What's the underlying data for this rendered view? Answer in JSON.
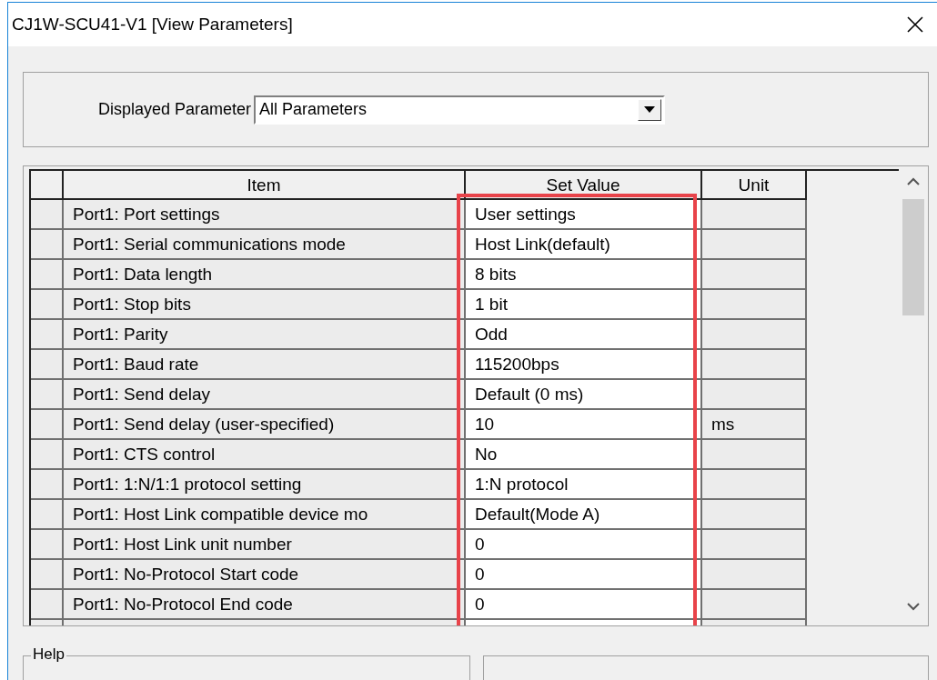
{
  "window": {
    "title": "CJ1W-SCU41-V1 [View Parameters]"
  },
  "filter": {
    "label": "Displayed Parameter",
    "value": "All Parameters"
  },
  "table": {
    "columns": [
      "Item",
      "Set Value",
      "Unit"
    ],
    "rows": [
      {
        "item": "Port1: Port settings",
        "value": "User settings"
      },
      {
        "item": "Port1: Serial communications mode",
        "value": "Host Link(default)"
      },
      {
        "item": "Port1: Data length",
        "value": "8 bits"
      },
      {
        "item": "Port1: Stop bits",
        "value": "1 bit"
      },
      {
        "item": "Port1: Parity",
        "value": "Odd"
      },
      {
        "item": "Port1: Baud rate",
        "value": "115200bps"
      },
      {
        "item": "Port1: Send delay",
        "value": "Default (0 ms)"
      },
      {
        "item": "Port1: Send delay (user-specified)",
        "value": "10",
        "unit": "ms"
      },
      {
        "item": "Port1: CTS control",
        "value": "No"
      },
      {
        "item": "Port1: 1:N/1:1 protocol setting",
        "value": "1:N protocol"
      },
      {
        "item": "Port1: Host Link compatible device mo",
        "value": "Default(Mode A)"
      },
      {
        "item": "Port1: Host Link unit number",
        "value": "0"
      },
      {
        "item": "Port1: No-Protocol Start code",
        "value": "0"
      },
      {
        "item": "Port1: No-Protocol End code",
        "value": "0"
      }
    ]
  },
  "help": {
    "label": "Help"
  }
}
